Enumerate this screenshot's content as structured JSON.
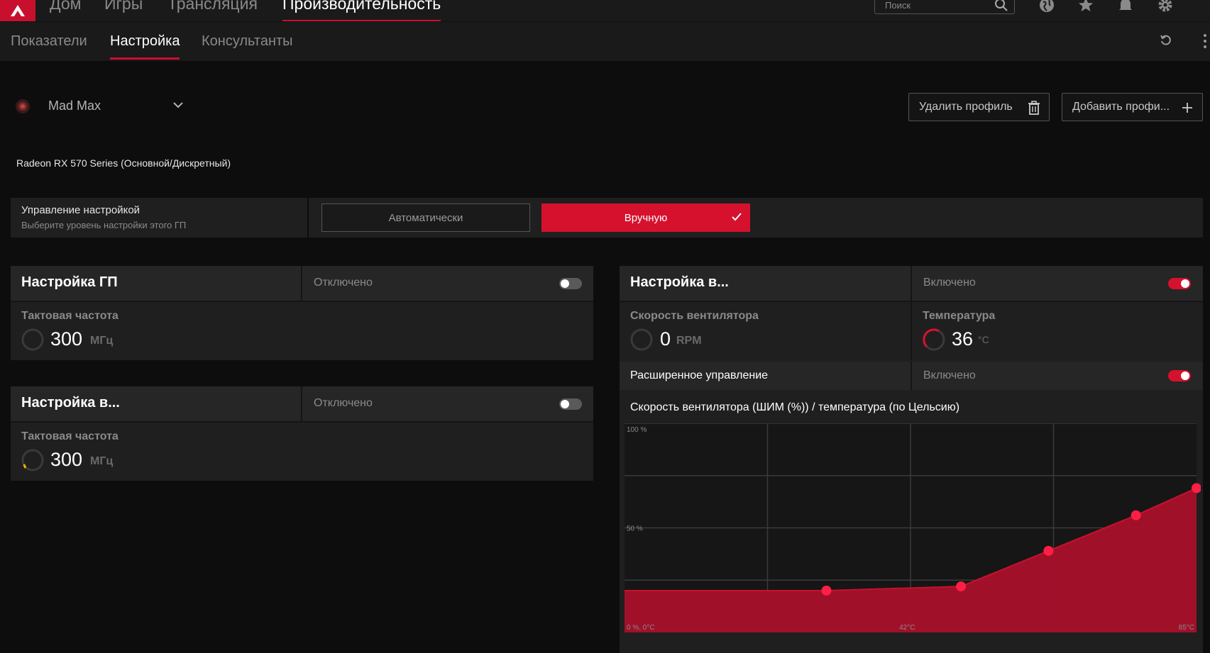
{
  "topnav": {
    "tabs": [
      {
        "label": "Дом"
      },
      {
        "label": "Игры"
      },
      {
        "label": "Трансляция"
      },
      {
        "label": "Производительность"
      }
    ],
    "search_placeholder": "Поиск",
    "icons": [
      "globe-icon",
      "star-icon",
      "bell-icon",
      "gear-icon"
    ]
  },
  "subnav": {
    "tabs": [
      {
        "label": "Показатели"
      },
      {
        "label": "Настройка"
      },
      {
        "label": "Консультанты"
      }
    ]
  },
  "profile": {
    "name": "Mad Max",
    "delete_label": "Удалить профиль",
    "add_label": "Добавить профи..."
  },
  "gpu_name": "Radeon RX 570 Series (Основной/Дискретный)",
  "tuning_control": {
    "title": "Управление настройкой",
    "subtitle": "Выберите уровень настройки этого ГП",
    "auto_label": "Автоматически",
    "manual_label": "Вручную",
    "selected": "manual"
  },
  "gpu_tuning": {
    "title": "Настройка ГП",
    "state": "Отключено",
    "enabled": false,
    "metric_label": "Тактовая частота",
    "metric_value": "300",
    "metric_unit": "МГц"
  },
  "vram_tuning": {
    "title": "Настройка в...",
    "state": "Отключено",
    "enabled": false,
    "metric_label": "Тактовая частота",
    "metric_value": "300",
    "metric_unit": "МГц"
  },
  "fan_tuning": {
    "title": "Настройка в...",
    "state": "Включено",
    "enabled": true,
    "fan_label": "Скорость вентилятора",
    "fan_value": "0",
    "fan_unit": "RPM",
    "temp_label": "Температура",
    "temp_value": "36",
    "temp_unit": "°C",
    "advanced_label": "Расширенное управление",
    "advanced_state": "Включено",
    "advanced_enabled": true,
    "chart_title": "Скорость вентилятора (ШИМ (%)) / температура (по Цельсию)"
  },
  "colors": {
    "accent": "#d6112e",
    "background": "#0d0d0d",
    "panel": "#1f1f1f"
  },
  "chart_data": {
    "type": "area",
    "title": "Скорость вентилятора (ШИМ (%)) / температура (по Цельсию)",
    "xlabel": "",
    "ylabel": "",
    "xlim": [
      0,
      85
    ],
    "ylim": [
      0,
      100
    ],
    "y_tick_labels": [
      "100 %",
      "50 %",
      "0 %, 0°C"
    ],
    "x_tick_labels": [
      "42°C",
      "85°C"
    ],
    "grid": true,
    "series": [
      {
        "x": [
          0,
          30,
          50,
          63,
          76,
          85
        ],
        "y": [
          20,
          20,
          22,
          39,
          56,
          69
        ]
      }
    ]
  }
}
